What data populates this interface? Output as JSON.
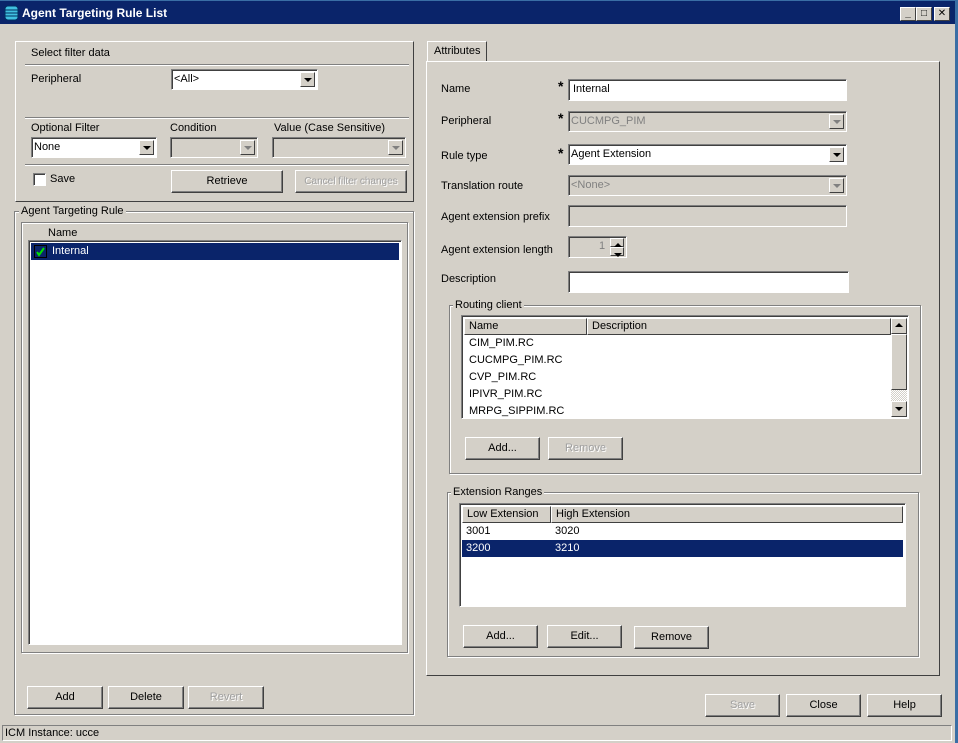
{
  "window": {
    "title": "Agent Targeting Rule List",
    "controls": {
      "minimize": "_",
      "maximize": "□",
      "close": "✕"
    }
  },
  "filter": {
    "group_title": "Select filter data",
    "peripheral_label": "Peripheral",
    "peripheral_value": "<All>",
    "optional_filter_label": "Optional Filter",
    "optional_filter_value": "None",
    "condition_label": "Condition",
    "condition_value": "",
    "value_label": "Value (Case Sensitive)",
    "value_value": "",
    "save_label": "Save",
    "save_checked": false,
    "retrieve_label": "Retrieve",
    "cancel_label": "Cancel filter changes"
  },
  "rule_list": {
    "group_title": "Agent Targeting Rule",
    "column_header": "Name",
    "items": [
      {
        "name": "Internal",
        "selected": true,
        "status_icon": "check-icon"
      }
    ],
    "buttons": {
      "add": "Add",
      "delete": "Delete",
      "revert": "Revert"
    }
  },
  "attributes": {
    "tab_label": "Attributes",
    "required_mark": "*",
    "name_label": "Name",
    "name_value": "Internal",
    "peripheral_label": "Peripheral",
    "peripheral_value": "CUCMPG_PIM",
    "rule_type_label": "Rule type",
    "rule_type_value": "Agent Extension",
    "translation_route_label": "Translation route",
    "translation_route_value": "<None>",
    "ext_prefix_label": "Agent extension prefix",
    "ext_prefix_value": "",
    "ext_length_label": "Agent extension length",
    "ext_length_value": "1",
    "description_label": "Description",
    "description_value": ""
  },
  "routing_client": {
    "group_title": "Routing client",
    "columns": [
      "Name",
      "Description"
    ],
    "rows": [
      {
        "name": "CIM_PIM.RC",
        "description": ""
      },
      {
        "name": "CUCMPG_PIM.RC",
        "description": ""
      },
      {
        "name": "CVP_PIM.RC",
        "description": ""
      },
      {
        "name": "IPIVR_PIM.RC",
        "description": ""
      },
      {
        "name": "MRPG_SIPPIM.RC",
        "description": ""
      }
    ],
    "buttons": {
      "add": "Add...",
      "remove": "Remove"
    }
  },
  "extension_ranges": {
    "group_title": "Extension Ranges",
    "columns": [
      "Low Extension",
      "High Extension"
    ],
    "rows": [
      {
        "low": "3001",
        "high": "3020",
        "selected": false
      },
      {
        "low": "3200",
        "high": "3210",
        "selected": true
      }
    ],
    "buttons": {
      "add": "Add...",
      "edit": "Edit...",
      "remove": "Remove"
    }
  },
  "footer": {
    "save": "Save",
    "close": "Close",
    "help": "Help"
  },
  "status": {
    "text": "ICM Instance: ucce"
  },
  "colors": {
    "titlebar": "#0a246a",
    "selection": "#0a246a",
    "face": "#d4d0c8",
    "check_green": "#00c000"
  }
}
